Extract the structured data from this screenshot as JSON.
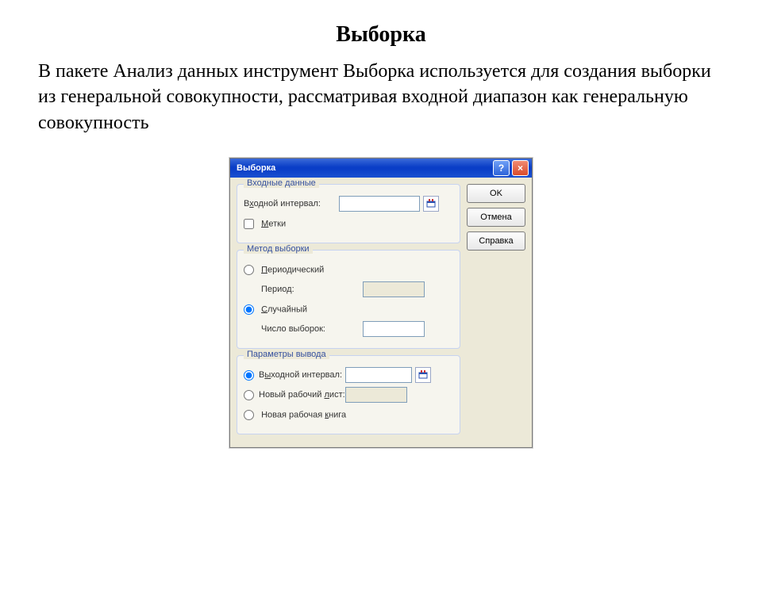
{
  "page": {
    "title": "Выборка",
    "body": "В пакете Анализ данных инструмент Выборка используется для создания выборки из генеральной совокупности, рассматривая входной диапазон как генеральную совокупность"
  },
  "dialog": {
    "title": "Выборка",
    "buttons": {
      "ok": "OK",
      "cancel": "Отмена",
      "help": "Справка"
    },
    "input_group": {
      "legend": "Входные данные",
      "range_label_pre": "В",
      "range_label_u": "х",
      "range_label_post": "одной интервал:",
      "range_value": "",
      "labels_pre": "",
      "labels_u": "М",
      "labels_post": "етки",
      "labels_checked": false
    },
    "method_group": {
      "legend": "Метод выборки",
      "periodic_pre": "",
      "periodic_u": "П",
      "periodic_post": "ериодический",
      "period_label": "Период:",
      "period_value": "",
      "random_pre": "",
      "random_u": "С",
      "random_post": "лучайный",
      "count_label": "Число выборок:",
      "count_value": "",
      "selected": "random"
    },
    "output_group": {
      "legend": "Параметры вывода",
      "out_range_pre": "В",
      "out_range_u": "ы",
      "out_range_post": "ходной интервал:",
      "out_range_value": "",
      "new_sheet_pre": "Новый рабочий ",
      "new_sheet_u": "л",
      "new_sheet_post": "ист:",
      "new_sheet_value": "",
      "new_book_pre": "Новая рабочая ",
      "new_book_u": "к",
      "new_book_post": "нига",
      "selected": "out_range"
    }
  }
}
